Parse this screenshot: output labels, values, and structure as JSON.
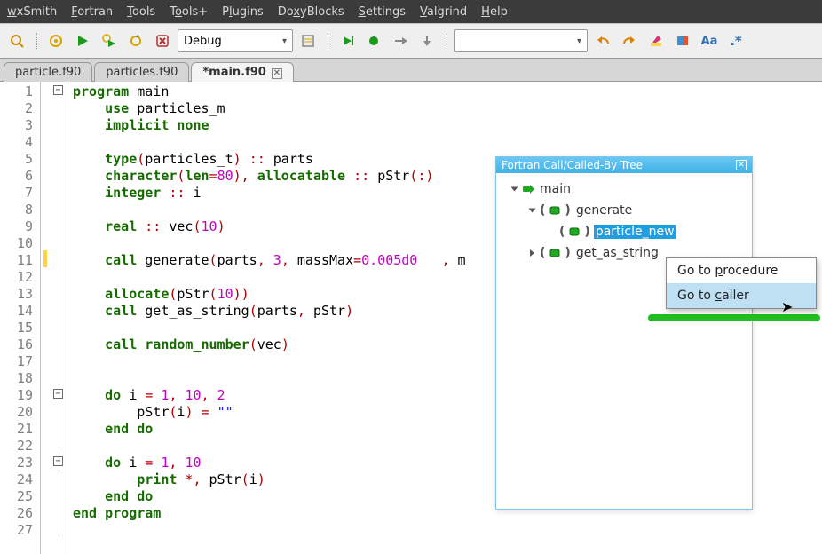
{
  "menu": {
    "items": [
      {
        "pre": "",
        "ul": "w",
        "post": "xSmith"
      },
      {
        "pre": "",
        "ul": "F",
        "post": "ortran"
      },
      {
        "pre": "",
        "ul": "T",
        "post": "ools"
      },
      {
        "pre": "T",
        "ul": "o",
        "post": "ols+"
      },
      {
        "pre": "P",
        "ul": "l",
        "post": "ugins"
      },
      {
        "pre": "Do",
        "ul": "x",
        "post": "yBlocks"
      },
      {
        "pre": "",
        "ul": "S",
        "post": "ettings"
      },
      {
        "pre": "",
        "ul": "V",
        "post": "algrind"
      },
      {
        "pre": "",
        "ul": "H",
        "post": "elp"
      }
    ]
  },
  "toolbar": {
    "build_config": "Debug",
    "search_text": ""
  },
  "tabs": [
    {
      "label": "particle.f90",
      "active": false,
      "dirty": false
    },
    {
      "label": "particles.f90",
      "active": false,
      "dirty": false
    },
    {
      "label": "*main.f90",
      "active": true,
      "dirty": true
    }
  ],
  "code": {
    "lines": [
      {
        "n": 1,
        "fold": "open",
        "html": "<span class='kw'>program</span> <span class='ident'>main</span>"
      },
      {
        "n": 2,
        "html": "    <span class='kw'>use</span> <span class='ident'>particles_m</span>"
      },
      {
        "n": 3,
        "html": "    <span class='kw'>implicit</span> <span class='kw'>none</span>"
      },
      {
        "n": 4,
        "html": ""
      },
      {
        "n": 5,
        "html": "    <span class='kw'>type</span><span class='paren'>(</span><span class='ident'>particles_t</span><span class='paren'>)</span> <span class='op'>::</span> <span class='ident'>parts</span>"
      },
      {
        "n": 6,
        "html": "    <span class='kw'>character</span><span class='paren'>(</span><span class='kw'>len</span><span class='op'>=</span><span class='num'>80</span><span class='paren'>)</span><span class='op'>,</span> <span class='kw'>allocatable</span> <span class='op'>::</span> <span class='ident'>pStr</span><span class='paren'>(</span><span class='op'>:</span><span class='paren'>)</span>"
      },
      {
        "n": 7,
        "html": "    <span class='kw'>integer</span> <span class='op'>::</span> <span class='ident'>i</span>"
      },
      {
        "n": 8,
        "html": ""
      },
      {
        "n": 9,
        "html": "    <span class='kw'>real</span> <span class='op'>::</span> <span class='ident'>vec</span><span class='paren'>(</span><span class='num'>10</span><span class='paren'>)</span>"
      },
      {
        "n": 10,
        "html": ""
      },
      {
        "n": 11,
        "mark": "changed",
        "html": "    <span class='kw'>call</span> <span class='ident'>generate</span><span class='paren'>(</span><span class='ident'>parts</span><span class='op'>,</span> <span class='num'>3</span><span class='op'>,</span> <span class='ident'>massMax</span><span class='op'>=</span><span class='num'>0.005d0</span>   <span class='op'>,</span> <span class='ident'>m</span>"
      },
      {
        "n": 12,
        "html": ""
      },
      {
        "n": 13,
        "html": "    <span class='kw'>allocate</span><span class='paren'>(</span><span class='ident'>pStr</span><span class='paren'>(</span><span class='num'>10</span><span class='paren'>))</span>"
      },
      {
        "n": 14,
        "html": "    <span class='kw'>call</span> <span class='ident'>get_as_string</span><span class='paren'>(</span><span class='ident'>parts</span><span class='op'>,</span> <span class='ident'>pStr</span><span class='paren'>)</span>"
      },
      {
        "n": 15,
        "html": ""
      },
      {
        "n": 16,
        "html": "    <span class='kw'>call</span> <span class='kw'>random_number</span><span class='paren'>(</span><span class='ident'>vec</span><span class='paren'>)</span>"
      },
      {
        "n": 17,
        "html": ""
      },
      {
        "n": 18,
        "html": ""
      },
      {
        "n": 19,
        "fold": "open",
        "html": "    <span class='kw'>do</span> <span class='ident'>i</span> <span class='op'>=</span> <span class='num'>1</span><span class='op'>,</span> <span class='num'>10</span><span class='op'>,</span> <span class='num'>2</span>"
      },
      {
        "n": 20,
        "html": "        <span class='ident'>pStr</span><span class='paren'>(</span><span class='ident'>i</span><span class='paren'>)</span> <span class='op'>=</span> <span class='str'>\"\"</span>"
      },
      {
        "n": 21,
        "html": "    <span class='kw'>end</span> <span class='kw'>do</span>"
      },
      {
        "n": 22,
        "html": ""
      },
      {
        "n": 23,
        "fold": "open",
        "html": "    <span class='kw'>do</span> <span class='ident'>i</span> <span class='op'>=</span> <span class='num'>1</span><span class='op'>,</span> <span class='num'>10</span>"
      },
      {
        "n": 24,
        "html": "        <span class='kw'>print</span> <span class='op'>*,</span> <span class='ident'>pStr</span><span class='paren'>(</span><span class='ident'>i</span><span class='paren'>)</span>"
      },
      {
        "n": 25,
        "html": "    <span class='kw'>end</span> <span class='kw'>do</span>"
      },
      {
        "n": 26,
        "html": "<span class='kw'>end</span> <span class='kw'>program</span>"
      },
      {
        "n": 27,
        "html": ""
      }
    ]
  },
  "call_tree": {
    "title": "Fortran Call/Called-By Tree",
    "nodes": [
      {
        "level": 1,
        "expander": "open",
        "icon": "arrow-green",
        "label": "main"
      },
      {
        "level": 2,
        "expander": "open",
        "icon": "box-green",
        "label": "generate"
      },
      {
        "level": 3,
        "expander": "none",
        "icon": "box-green",
        "label": "particle_new",
        "selected": true
      },
      {
        "level": 2,
        "expander": "closed",
        "icon": "box-green",
        "label": "get_as_string"
      }
    ]
  },
  "context_menu": {
    "items": [
      {
        "pre": "Go to ",
        "ul": "p",
        "post": "rocedure",
        "hl": false
      },
      {
        "pre": "Go to ",
        "ul": "c",
        "post": "aller",
        "hl": true
      }
    ]
  }
}
